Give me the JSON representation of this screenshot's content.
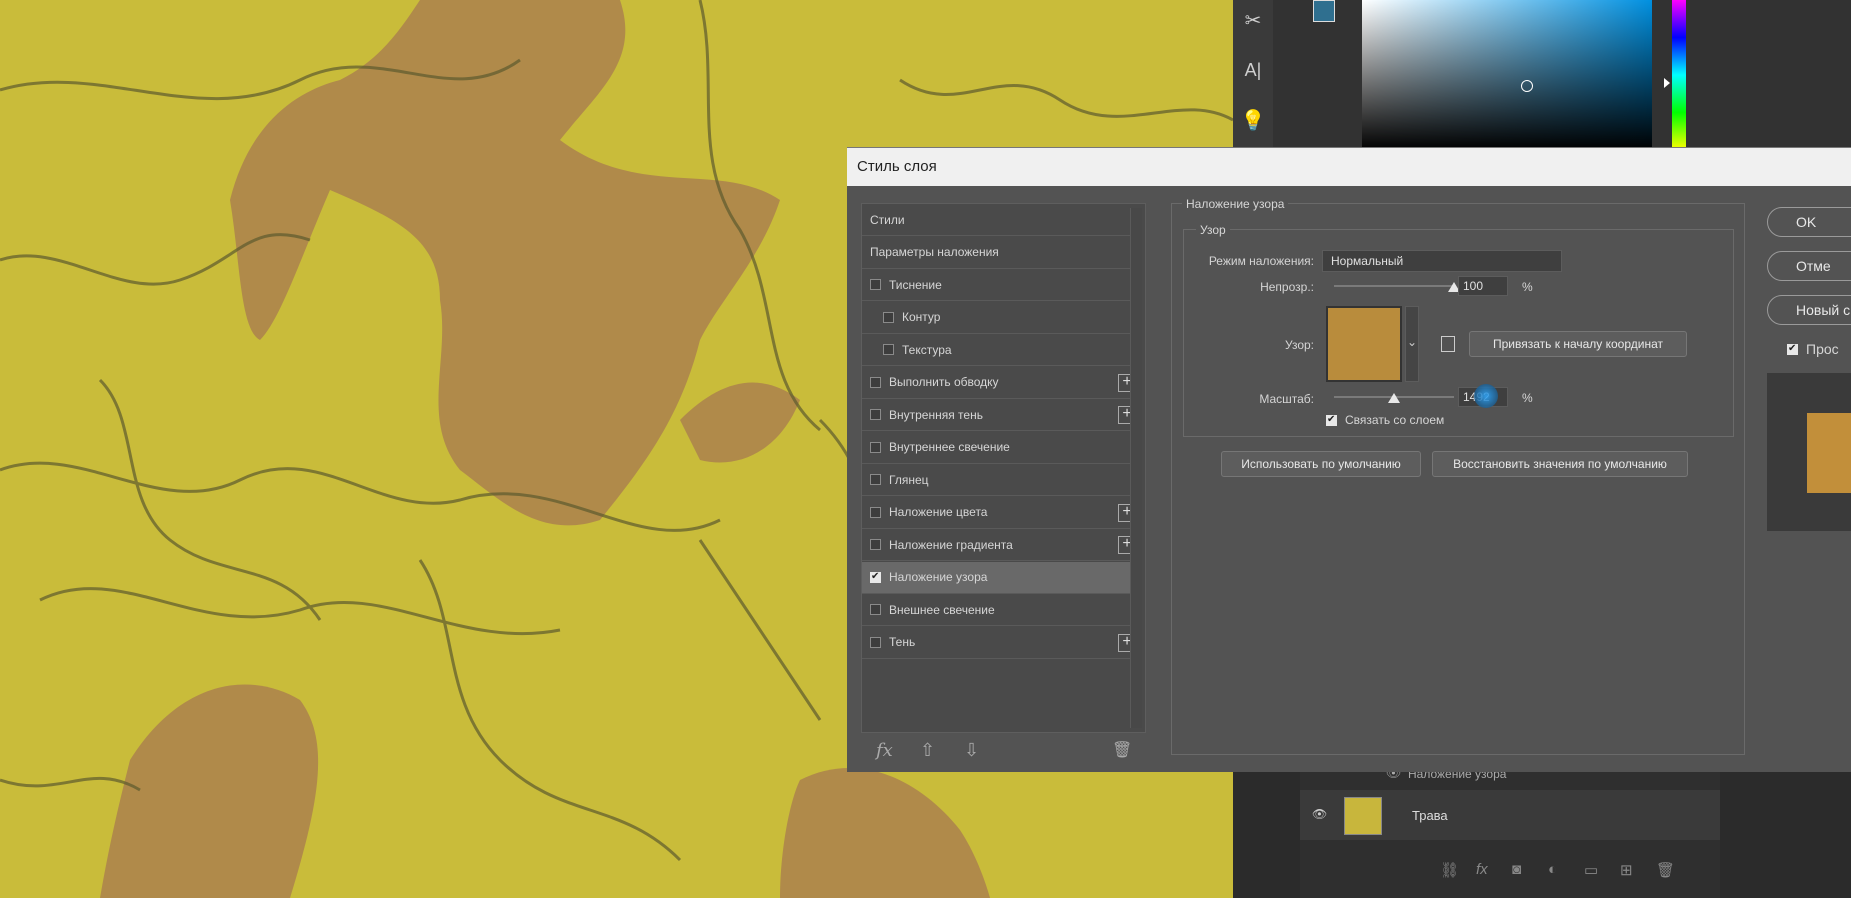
{
  "dialog": {
    "title": "Стиль слоя",
    "styles_list": [
      {
        "label": "Стили",
        "checkbox": false,
        "checked": false,
        "plus": false,
        "indent": 0
      },
      {
        "label": "Параметры наложения",
        "checkbox": false,
        "checked": false,
        "plus": false,
        "indent": 0
      },
      {
        "label": "Тиснение",
        "checkbox": true,
        "checked": false,
        "plus": false,
        "indent": 0
      },
      {
        "label": "Контур",
        "checkbox": true,
        "checked": false,
        "plus": false,
        "indent": 1
      },
      {
        "label": "Текстура",
        "checkbox": true,
        "checked": false,
        "plus": false,
        "indent": 1
      },
      {
        "label": "Выполнить обводку",
        "checkbox": true,
        "checked": false,
        "plus": true,
        "indent": 0
      },
      {
        "label": "Внутренняя тень",
        "checkbox": true,
        "checked": false,
        "plus": true,
        "indent": 0
      },
      {
        "label": "Внутреннее свечение",
        "checkbox": true,
        "checked": false,
        "plus": false,
        "indent": 0
      },
      {
        "label": "Глянец",
        "checkbox": true,
        "checked": false,
        "plus": false,
        "indent": 0
      },
      {
        "label": "Наложение цвета",
        "checkbox": true,
        "checked": false,
        "plus": true,
        "indent": 0
      },
      {
        "label": "Наложение градиента",
        "checkbox": true,
        "checked": false,
        "plus": true,
        "indent": 0
      },
      {
        "label": "Наложение узора",
        "checkbox": true,
        "checked": true,
        "plus": false,
        "indent": 0,
        "selected": true
      },
      {
        "label": "Внешнее свечение",
        "checkbox": true,
        "checked": false,
        "plus": false,
        "indent": 0
      },
      {
        "label": "Тень",
        "checkbox": true,
        "checked": false,
        "plus": true,
        "indent": 0
      }
    ],
    "footer": {
      "fx": "fx",
      "up": "⇧",
      "down": "⇩",
      "trash": "🗑"
    },
    "section_title": "Наложение узора",
    "group_title": "Узор",
    "blend_mode_label": "Режим наложения:",
    "blend_mode_value": "Нормальный",
    "opacity_label": "Непрозр.:",
    "opacity_value": "100",
    "opacity_unit": "%",
    "opacity_fraction": 1.0,
    "pattern_label": "Узор:",
    "snap_button": "Привязать к началу координат",
    "scale_label": "Масштаб:",
    "scale_value": "1492",
    "scale_unit": "%",
    "scale_fraction": 0.5,
    "link_label": "Связать со слоем",
    "link_checked": true,
    "make_default": "Использовать по умолчанию",
    "reset_default": "Восстановить значения по умолчанию",
    "right_buttons": [
      "OK",
      "Отме",
      "Новый с"
    ],
    "preview_label": "Прос",
    "preview_checked": true
  },
  "layers": {
    "effect_label": "Наложение узора",
    "layer_name": "Трава"
  },
  "colors": {
    "canvas": "#c9bc3a",
    "dirt": "#b08a4a",
    "dialog": "#535353"
  }
}
